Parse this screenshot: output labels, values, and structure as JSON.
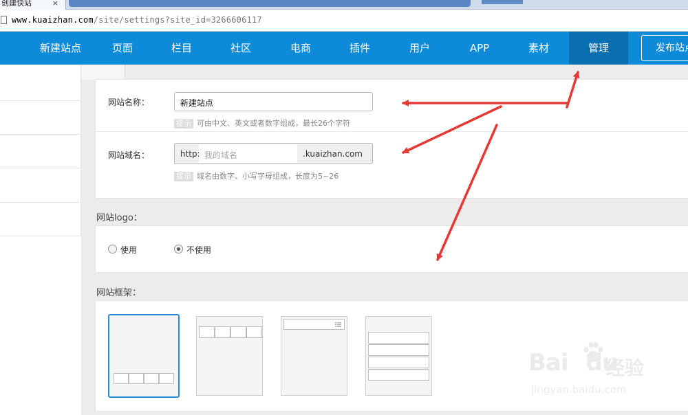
{
  "browser": {
    "tab_title": "创建快站",
    "tab_close": "×",
    "url_host": "www.kuaizhan.com",
    "url_path": "/site/settings?site_id=3266606117"
  },
  "nav": {
    "items": [
      "新建站点",
      "页面",
      "栏目",
      "社区",
      "电商",
      "插件",
      "用户",
      "APP",
      "素材",
      "管理"
    ],
    "active_index": 9,
    "publish_label": "发布站点"
  },
  "form": {
    "site_name_label": "网站名称：",
    "site_name_value": "新建站点",
    "site_name_hint_tag": "提示",
    "site_name_hint": "可由中文、英文或者数字组成，最长26个字符",
    "domain_label": "网站域名：",
    "domain_prefix": "http://",
    "domain_placeholder": "我的域名",
    "domain_suffix": ".kuaizhan.com",
    "domain_hint_tag": "提示",
    "domain_hint": "域名由数字、小写字母组成，长度为5~26"
  },
  "logo": {
    "title": "网站logo：",
    "options": [
      "使用",
      "不使用"
    ],
    "selected": "不使用"
  },
  "frames": {
    "title": "网站框架：",
    "selected_index": 0
  },
  "watermark": {
    "brand": "Bai",
    "brand2": "du",
    "cn": "经验",
    "url": "jingyan.baidu.com"
  },
  "colors": {
    "nav_bg": "#0e8bd8",
    "nav_active": "#0a6fb0",
    "arrow": "#e53935",
    "frame_selected": "#2a8ad4"
  }
}
